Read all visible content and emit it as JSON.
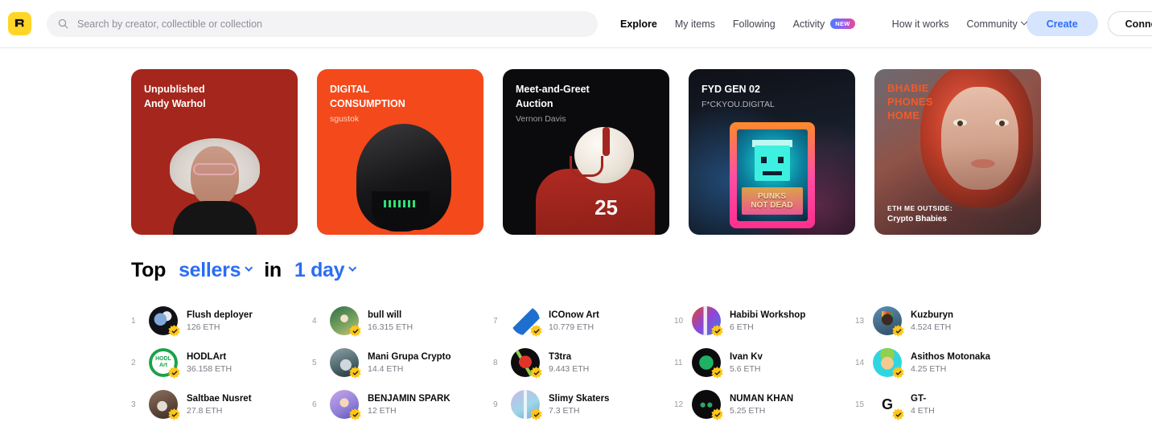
{
  "header": {
    "logo_icon": "rarible-logo-icon",
    "search": {
      "icon": "search-icon",
      "placeholder": "Search by creator, collectible or collection",
      "value": ""
    },
    "nav": [
      {
        "label": "Explore",
        "active": true
      },
      {
        "label": "My items",
        "active": false
      },
      {
        "label": "Following",
        "active": false
      },
      {
        "label": "Activity",
        "active": false,
        "badge": "NEW"
      },
      {
        "label": "How it works",
        "active": false
      },
      {
        "label": "Community",
        "active": false,
        "caret": true
      }
    ],
    "create_label": "Create",
    "connect_label": "Connect wallet"
  },
  "featured_cards": [
    {
      "title": "Unpublished\nAndy Warhol",
      "subtitle": "",
      "title_color": "#ffffff",
      "subtitle_color": "#f0c9c4",
      "bg": "#a5261c"
    },
    {
      "title": "DIGITAL\nCONSUMPTION",
      "subtitle": "sgustok",
      "title_color": "#ffffff",
      "subtitle_color": "#ffd3c2",
      "bg": "#f4491b"
    },
    {
      "title": "Meet-and-Greet\nAuction",
      "subtitle": "Vernon Davis",
      "title_color": "#ffffff",
      "subtitle_color": "#9e9ea6",
      "bg": "#0b0b0d"
    },
    {
      "title": "FYD GEN 02",
      "subtitle": "F*CKYOU.DIGITAL",
      "title_color": "#ffffff",
      "subtitle_color": "#b6b6bd",
      "bg": "#101018"
    },
    {
      "title": "BHABIE\nPHONES\nHOME",
      "footer_top": "ETH ME OUTSIDE:",
      "footer_bottom": "Crypto Bhabies",
      "title_color": "#f15a2b",
      "bg": "#5d3433"
    }
  ],
  "top_sellers": {
    "heading_prefix": "Top",
    "category": "sellers",
    "heading_middle": "in",
    "period": "1 day",
    "currency": "ETH",
    "columns": [
      [
        {
          "rank": "1",
          "name": "Flush deployer",
          "value": "126 ETH",
          "verified": true
        },
        {
          "rank": "2",
          "name": "HODLArt",
          "value": "36.158 ETH",
          "verified": true
        },
        {
          "rank": "3",
          "name": "Saltbae Nusret",
          "value": "27.8 ETH",
          "verified": true
        }
      ],
      [
        {
          "rank": "4",
          "name": "bull will",
          "value": "16.315 ETH",
          "verified": true
        },
        {
          "rank": "5",
          "name": "Mani Grupa Crypto",
          "value": "14.4 ETH",
          "verified": true
        },
        {
          "rank": "6",
          "name": "BENJAMIN SPARK",
          "value": "12 ETH",
          "verified": true
        }
      ],
      [
        {
          "rank": "7",
          "name": "ICOnow Art",
          "value": "10.779 ETH",
          "verified": true
        },
        {
          "rank": "8",
          "name": "T3tra",
          "value": "9.443 ETH",
          "verified": true
        },
        {
          "rank": "9",
          "name": "Slimy Skaters",
          "value": "7.3 ETH",
          "verified": true
        }
      ],
      [
        {
          "rank": "10",
          "name": "Habibi Workshop",
          "value": "6 ETH",
          "verified": true
        },
        {
          "rank": "11",
          "name": "Ivan Kv",
          "value": "5.6 ETH",
          "verified": true
        },
        {
          "rank": "12",
          "name": "NUMAN KHAN",
          "value": "5.25 ETH",
          "verified": true
        }
      ],
      [
        {
          "rank": "13",
          "name": "Kuzburyn",
          "value": "4.524 ETH",
          "verified": true
        },
        {
          "rank": "14",
          "name": "Asithos Motonaka",
          "value": "4.25 ETH",
          "verified": true
        },
        {
          "rank": "15",
          "name": "GT-",
          "value": "4 ETH",
          "verified": true
        }
      ]
    ]
  },
  "colors": {
    "accent_blue": "#2a6df5",
    "create_bg": "#d7e4fd",
    "logo_yellow": "#ffd627",
    "verified_badge": "#ffc61a",
    "text_muted": "#7a7a85"
  }
}
